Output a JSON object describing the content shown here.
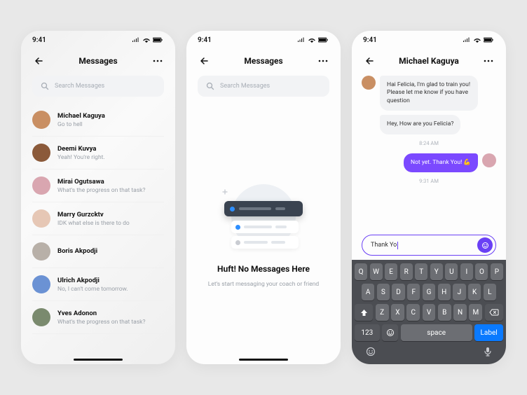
{
  "status": {
    "time": "9:41"
  },
  "screen1": {
    "title": "Messages",
    "searchPlaceholder": "Search Messages",
    "items": [
      {
        "name": "Michael Kaguya",
        "preview": "Go to hell",
        "color": "#c98f63"
      },
      {
        "name": "Deemi Kuvya",
        "preview": "Yeah! You're right.",
        "color": "#8b5a3a"
      },
      {
        "name": "Mirai Ogutsawa",
        "preview": "What's the progress on that task?",
        "color": "#d9a6b0"
      },
      {
        "name": "Marry Gurzcktv",
        "preview": "IDK what else is there to do",
        "color": "#e6c7b5"
      },
      {
        "name": "Boris Akpodji",
        "preview": "",
        "color": "#b8b0a8"
      },
      {
        "name": "Ulrich Akpodji",
        "preview": "No, I can't come tomorrow.",
        "color": "#6b92d4"
      },
      {
        "name": "Yves Adonon",
        "preview": "What's the progress on that task?",
        "color": "#7a8a6e"
      }
    ]
  },
  "screen2": {
    "title": "Messages",
    "searchPlaceholder": "Search Messages",
    "emptyTitle": "Huft! No Messages Here",
    "emptySub": "Let's start messaging your coach or friend"
  },
  "screen3": {
    "title": "Michael Kaguya",
    "messages": [
      {
        "dir": "in",
        "text": "Hai Felicia, I'm glad to train you! Please let me know if you have question"
      },
      {
        "dir": "in",
        "text": "Hey, How are you Felicia?"
      }
    ],
    "timeIn": "8:24 AM",
    "out": {
      "text": "Not yet. Thank You! 💪"
    },
    "timeOut": "9:31 AM",
    "compose": "Thank Yo",
    "keyboard": {
      "row1": [
        "Q",
        "W",
        "E",
        "R",
        "T",
        "Y",
        "U",
        "I",
        "O",
        "P"
      ],
      "row2": [
        "A",
        "S",
        "D",
        "F",
        "G",
        "H",
        "J",
        "K",
        "L"
      ],
      "row3": [
        "Z",
        "X",
        "C",
        "V",
        "B",
        "N",
        "M"
      ],
      "labels": {
        "numeric": "123",
        "space": "space",
        "label": "Label"
      }
    },
    "avatarIn": "#c98f63",
    "avatarOut": "#d9a6b0"
  }
}
